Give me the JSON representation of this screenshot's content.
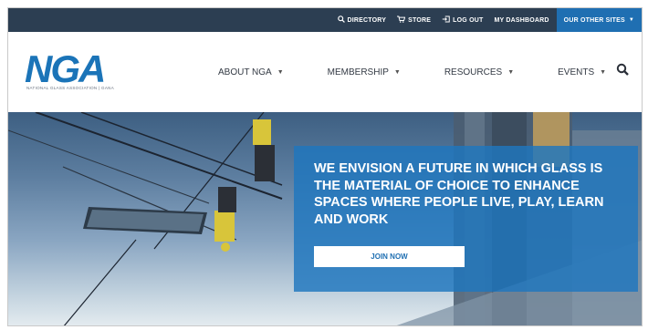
{
  "utility": {
    "links": [
      {
        "label": "DIRECTORY",
        "icon": "search-icon"
      },
      {
        "label": "STORE",
        "icon": "cart-icon"
      },
      {
        "label": "LOG OUT",
        "icon": "logout-icon"
      },
      {
        "label": "MY DASHBOARD"
      }
    ],
    "other_sites": "OUR OTHER SITES"
  },
  "logo": {
    "mark": "NGA",
    "tagline": "NATIONAL GLASS ASSOCIATION | GANA"
  },
  "nav": {
    "items": [
      {
        "label": "ABOUT NGA"
      },
      {
        "label": "MEMBERSHIP"
      },
      {
        "label": "RESOURCES"
      },
      {
        "label": "EVENTS"
      }
    ]
  },
  "hero": {
    "headline": "WE ENVISION A FUTURE IN WHICH GLASS IS THE MATERIAL OF CHOICE TO ENHANCE SPACES WHERE PEOPLE LIVE, PLAY, LEARN AND WORK",
    "cta": "JOIN NOW"
  },
  "colors": {
    "utility_bar": "#2c3e52",
    "accent": "#1f6fb2",
    "logo": "#1b74b8"
  }
}
